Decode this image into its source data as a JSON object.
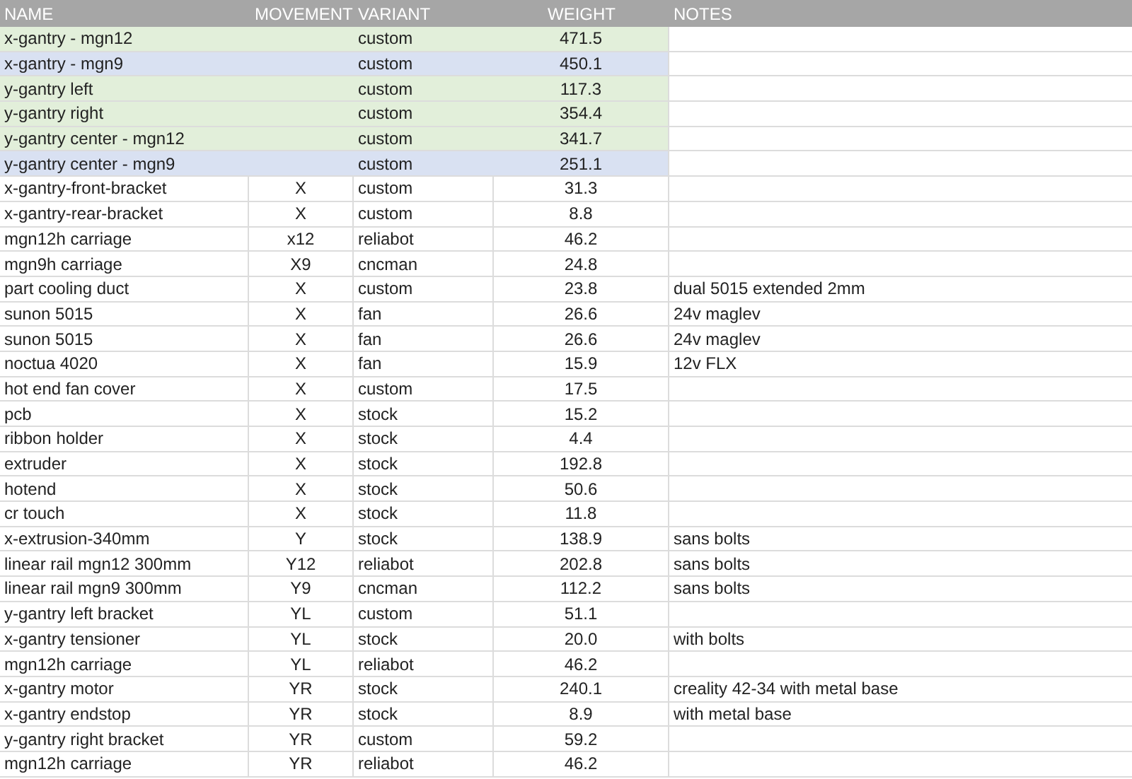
{
  "columns": [
    "NAME",
    "MOVEMENT",
    "VARIANT",
    "WEIGHT",
    "NOTES"
  ],
  "rows": [
    {
      "name": "x-gantry - mgn12",
      "movement": "",
      "variant": "custom",
      "weight": "471.5",
      "notes": "",
      "color": "#e2efda"
    },
    {
      "name": "x-gantry - mgn9",
      "movement": "",
      "variant": "custom",
      "weight": "450.1",
      "notes": "",
      "color": "#d9e1f2"
    },
    {
      "name": "y-gantry left",
      "movement": "",
      "variant": "custom",
      "weight": "117.3",
      "notes": "",
      "color": "#e2efda"
    },
    {
      "name": "y-gantry right",
      "movement": "",
      "variant": "custom",
      "weight": "354.4",
      "notes": "",
      "color": "#e2efda"
    },
    {
      "name": "y-gantry center - mgn12",
      "movement": "",
      "variant": "custom",
      "weight": "341.7",
      "notes": "",
      "color": "#e2efda"
    },
    {
      "name": "y-gantry center - mgn9",
      "movement": "",
      "variant": "custom",
      "weight": "251.1",
      "notes": "",
      "color": "#d9e1f2"
    },
    {
      "name": "x-gantry-front-bracket",
      "movement": "X",
      "variant": "custom",
      "weight": "31.3",
      "notes": ""
    },
    {
      "name": "x-gantry-rear-bracket",
      "movement": "X",
      "variant": "custom",
      "weight": "8.8",
      "notes": ""
    },
    {
      "name": "mgn12h carriage",
      "movement": "x12",
      "variant": "reliabot",
      "weight": "46.2",
      "notes": ""
    },
    {
      "name": "mgn9h carriage",
      "movement": "X9",
      "variant": "cncman",
      "weight": "24.8",
      "notes": ""
    },
    {
      "name": "part cooling duct",
      "movement": "X",
      "variant": "custom",
      "weight": "23.8",
      "notes": "dual 5015 extended 2mm"
    },
    {
      "name": "sunon 5015",
      "movement": "X",
      "variant": "fan",
      "weight": "26.6",
      "notes": "24v maglev"
    },
    {
      "name": "sunon 5015",
      "movement": "X",
      "variant": "fan",
      "weight": "26.6",
      "notes": "24v maglev"
    },
    {
      "name": "noctua 4020",
      "movement": "X",
      "variant": "fan",
      "weight": "15.9",
      "notes": "12v FLX"
    },
    {
      "name": "hot end fan cover",
      "movement": "X",
      "variant": "custom",
      "weight": "17.5",
      "notes": ""
    },
    {
      "name": "pcb",
      "movement": "X",
      "variant": "stock",
      "weight": "15.2",
      "notes": ""
    },
    {
      "name": "ribbon holder",
      "movement": "X",
      "variant": "stock",
      "weight": "4.4",
      "notes": ""
    },
    {
      "name": "extruder",
      "movement": "X",
      "variant": "stock",
      "weight": "192.8",
      "notes": ""
    },
    {
      "name": "hotend",
      "movement": "X",
      "variant": "stock",
      "weight": "50.6",
      "notes": ""
    },
    {
      "name": "cr touch",
      "movement": "X",
      "variant": "stock",
      "weight": "11.8",
      "notes": ""
    },
    {
      "name": "x-extrusion-340mm",
      "movement": "Y",
      "variant": "stock",
      "weight": "138.9",
      "notes": "sans bolts"
    },
    {
      "name": "linear rail mgn12 300mm",
      "movement": "Y12",
      "variant": "reliabot",
      "weight": "202.8",
      "notes": "sans bolts"
    },
    {
      "name": "linear rail mgn9 300mm",
      "movement": "Y9",
      "variant": "cncman",
      "weight": "112.2",
      "notes": "sans bolts"
    },
    {
      "name": "y-gantry left bracket",
      "movement": "YL",
      "variant": "custom",
      "weight": "51.1",
      "notes": ""
    },
    {
      "name": "x-gantry tensioner",
      "movement": "YL",
      "variant": "stock",
      "weight": "20.0",
      "notes": "with bolts"
    },
    {
      "name": "mgn12h carriage",
      "movement": "YL",
      "variant": "reliabot",
      "weight": "46.2",
      "notes": ""
    },
    {
      "name": "x-gantry motor",
      "movement": "YR",
      "variant": "stock",
      "weight": "240.1",
      "notes": "creality 42-34 with metal base"
    },
    {
      "name": "x-gantry endstop",
      "movement": "YR",
      "variant": "stock",
      "weight": "8.9",
      "notes": "with metal base"
    },
    {
      "name": "y-gantry right bracket",
      "movement": "YR",
      "variant": "custom",
      "weight": "59.2",
      "notes": ""
    },
    {
      "name": "mgn12h carriage",
      "movement": "YR",
      "variant": "reliabot",
      "weight": "46.2",
      "notes": ""
    }
  ]
}
